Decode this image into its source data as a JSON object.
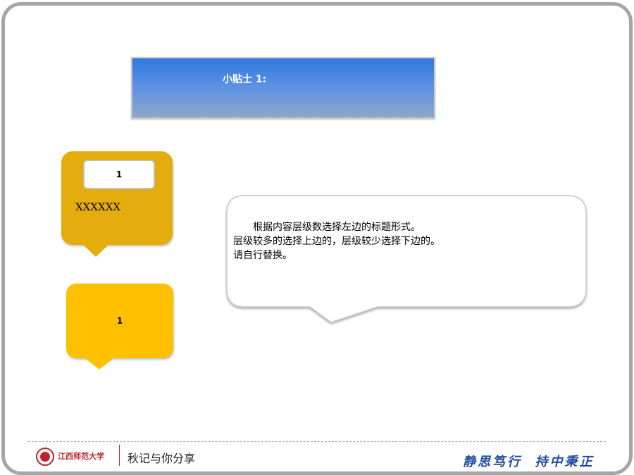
{
  "tip": {
    "title": "小贴士 1:"
  },
  "bubble1": {
    "number": "1",
    "text": "XXXXXX",
    "color": "#e5ac0e"
  },
  "bubble2": {
    "number": "1",
    "color": "#ffc000"
  },
  "speech": {
    "lines": [
      "根据内容层级数选择左边的标题形式。",
      "层级较多的选择上边的，层级较少选择下边的。",
      "请自行替换。"
    ]
  },
  "footer": {
    "university": "江西师范大学",
    "caption": "秋记与你分享",
    "motto": "静思笃行  持中秉正",
    "brand_color": "#c0242a",
    "motto_color": "#1f4d9e"
  }
}
